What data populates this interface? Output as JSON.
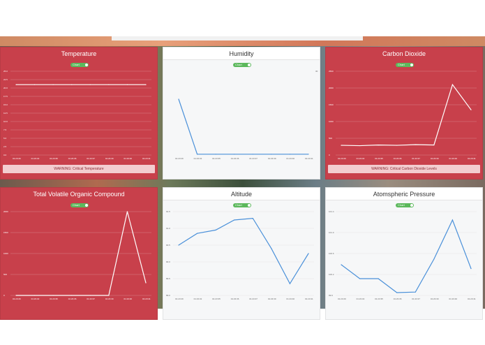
{
  "cards": {
    "temperature": {
      "title": "Temperature",
      "toggle_label": "Chart",
      "warning": "WARNING: Critical Temperature",
      "style": "red",
      "chart_data": {
        "type": "line",
        "x": [
          "01:23:29",
          "01:23:32",
          "01:23:35",
          "01:23:36",
          "01:23:37",
          "01:23:39",
          "01:23:40",
          "01:23:41"
        ],
        "y": [
          21,
          21,
          21,
          21,
          21,
          21,
          21,
          21
        ],
        "ylim": [
          0,
          25
        ],
        "yticks": [
          "25.0",
          "22.5",
          "20.0",
          "17.5",
          "15.0",
          "12.5",
          "10.0",
          "7.5",
          "5.0",
          "2.5",
          "0.0"
        ],
        "line_color": "#ffffff"
      }
    },
    "humidity": {
      "title": "Humidity",
      "toggle_label": "Chart",
      "style": "light",
      "chart_data": {
        "type": "line",
        "x": [
          "01:23:29",
          "01:23:32",
          "01:23:35",
          "01:23:36",
          "01:23:37",
          "01:23:39",
          "01:23:40",
          "01:23:41"
        ],
        "y": [
          20,
          0.3,
          0.3,
          0.3,
          0.3,
          0.3,
          0.3,
          0.3
        ],
        "ylim": [
          0,
          30
        ],
        "yticks": [
          "30"
        ],
        "line_color": "#4a90d9"
      }
    },
    "co2": {
      "title": "Carbon Dioxide",
      "toggle_label": "Chart",
      "warning": "WARNING: Critical Carbon Dioxide Levels",
      "style": "red",
      "chart_data": {
        "type": "line",
        "x": [
          "01:23:29",
          "01:23:32",
          "01:23:35",
          "01:23:36",
          "01:23:37",
          "01:23:39",
          "01:23:40",
          "01:23:41"
        ],
        "y": [
          290,
          280,
          300,
          290,
          310,
          300,
          2100,
          1350
        ],
        "ylim": [
          0,
          2500
        ],
        "yticks": [
          "2500",
          "2000",
          "1500",
          "1000",
          "500",
          "0"
        ],
        "line_color": "#ffffff"
      }
    },
    "tvoc": {
      "title": "Total Volatile Organic Compound",
      "toggle_label": "Chart",
      "style": "red",
      "chart_data": {
        "type": "line",
        "x": [
          "01:23:29",
          "01:23:32",
          "01:23:35",
          "01:23:36",
          "01:23:37",
          "01:23:39",
          "01:23:40",
          "01:23:41"
        ],
        "y": [
          0,
          0,
          0,
          0,
          0,
          0,
          2000,
          300
        ],
        "ylim": [
          0,
          2000
        ],
        "yticks": [
          "2000",
          "1500",
          "1000",
          "500",
          "0"
        ],
        "line_color": "#ffffff"
      }
    },
    "altitude": {
      "title": "Altitude",
      "toggle_label": "Chart",
      "style": "light",
      "chart_data": {
        "type": "line",
        "x": [
          "01:23:29",
          "01:23:32",
          "01:23:35",
          "01:23:36",
          "01:23:37",
          "01:23:39",
          "01:23:40",
          "01:23:41"
        ],
        "y": [
          90.5,
          90.85,
          90.95,
          91.25,
          91.3,
          90.4,
          89.35,
          90.25
        ],
        "ylim": [
          89,
          91.5
        ],
        "yticks": [
          "91.5",
          "91.0",
          "90.5",
          "90.0",
          "89.5",
          "89.0"
        ],
        "line_color": "#4a90d9"
      }
    },
    "pressure": {
      "title": "Atomspheric Pressure",
      "toggle_label": "Chart",
      "style": "light",
      "chart_data": {
        "type": "line",
        "x": [
          "01:23:29",
          "01:23:32",
          "01:23:35",
          "01:23:36",
          "01:23:37",
          "01:23:39",
          "01:23:40",
          "01:23:41"
        ],
        "y": [
          100.45,
          100.2,
          100.2,
          99.95,
          99.96,
          100.55,
          101.25,
          100.38
        ],
        "ylim": [
          99.9,
          101.4
        ],
        "yticks": [
          "101.4",
          "101.0",
          "100.6",
          "100.2",
          "99.9"
        ],
        "line_color": "#4a90d9"
      }
    }
  }
}
